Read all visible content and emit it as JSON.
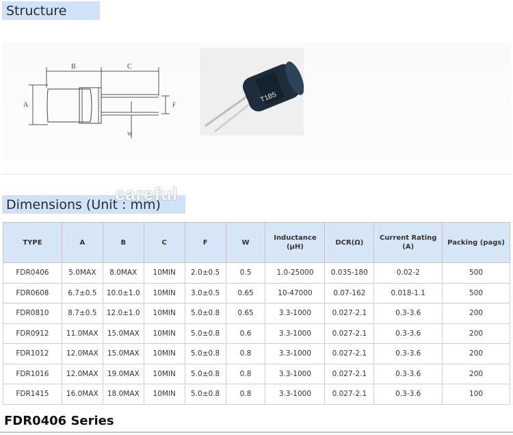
{
  "sections": {
    "structure": "Structure",
    "dimensions": "Dimensions (Unit : mm)"
  },
  "watermark": "careful",
  "drawing": {
    "label_a": "A",
    "label_b": "B",
    "label_c": "C",
    "label_f": "F",
    "label_w": "W"
  },
  "photo": {
    "marking": "T1B5"
  },
  "table": {
    "headers": [
      "TYPE",
      "A",
      "B",
      "C",
      "F",
      "W",
      "Inductance (μH)",
      "DCR(Ω)",
      "Current Rating (A)",
      "Packing (pags)"
    ],
    "rows": [
      [
        "FDR0406",
        "5.0MAX",
        "8.0MAX",
        "10MIN",
        "2.0±0.5",
        "0.5",
        "1.0-25000",
        "0.035-180",
        "0.02-2",
        "500"
      ],
      [
        "FDR0608",
        "6.7±0.5",
        "10.0±1.0",
        "10MIN",
        "3.0±0.5",
        "0.65",
        "10-47000",
        "0.07-162",
        "0.018-1.1",
        "500"
      ],
      [
        "FDR0810",
        "8.7±0.5",
        "12.0±1.0",
        "10MIN",
        "5.0±0.8",
        "0.65",
        "3.3-1000",
        "0.027-2.1",
        "0.3-3.6",
        "200"
      ],
      [
        "FDR0912",
        "11.0MAX",
        "15.0MAX",
        "10MIN",
        "5.0±0.8",
        "0.6",
        "3.3-1000",
        "0.027-2.1",
        "0.3-3.6",
        "200"
      ],
      [
        "FDR1012",
        "12.0MAX",
        "15.0MAX",
        "10MIN",
        "5.0±0.8",
        "0.8",
        "3.3-1000",
        "0.027-2.1",
        "0.3-3.6",
        "200"
      ],
      [
        "FDR1016",
        "12.0MAX",
        "19.0MAX",
        "10MIN",
        "5.0±0.8",
        "0.8",
        "3.3-1000",
        "0.027-2.1",
        "0.3-3.6",
        "200"
      ],
      [
        "FDR1415",
        "16.0MAX",
        "18.0MAX",
        "10MIN",
        "5.0±0.8",
        "0.8",
        "3.3-1000",
        "0.027-2.1",
        "0.3-3.6",
        "100"
      ]
    ]
  },
  "series_title": "FDR0406 Series",
  "colors": {
    "tag_background": "#cfe2f7",
    "header_background": "#d6e6f6"
  }
}
